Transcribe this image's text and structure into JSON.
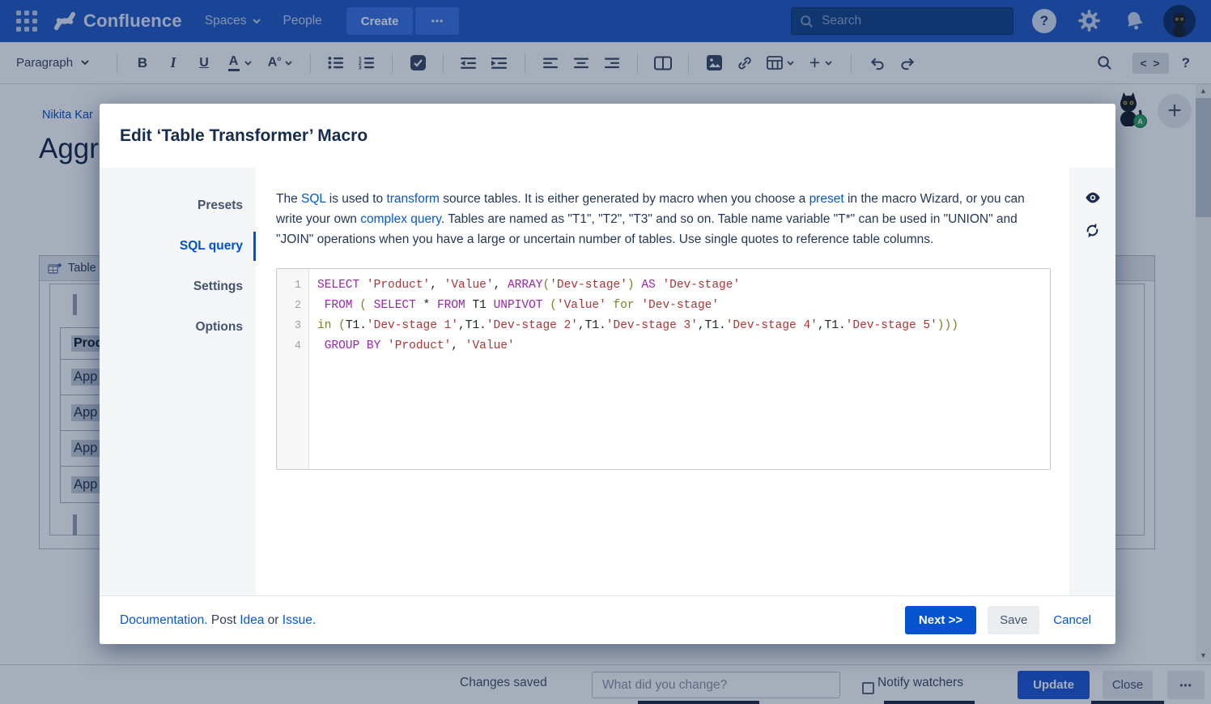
{
  "nav": {
    "brand": "Confluence",
    "spaces_label": "Spaces",
    "people_label": "People",
    "create_label": "Create",
    "more_label": "•••",
    "search_placeholder": "Search",
    "help_label": "?"
  },
  "toolbar": {
    "paragraph_label": "Paragraph",
    "code_view_label": "< >",
    "help_label": "?",
    "plus_label": "+"
  },
  "background": {
    "breadcrumb": "Nikita Kar",
    "page_title": "Aggr",
    "macro_label": "Table",
    "table": {
      "header": "Prod",
      "rows": [
        "App '",
        "App '",
        "App '",
        "App '"
      ]
    },
    "collab_badge": "A",
    "plus_label": "+"
  },
  "dialog": {
    "title": "Edit ‘Table Transformer’ Macro",
    "tabs": [
      {
        "label": "Presets",
        "active": false
      },
      {
        "label": "SQL query",
        "active": true
      },
      {
        "label": "Settings",
        "active": false
      },
      {
        "label": "Options",
        "active": false
      }
    ],
    "description": [
      {
        "t": "The "
      },
      {
        "t": "SQL",
        "link": true
      },
      {
        "t": " is used to "
      },
      {
        "t": "transform",
        "link": true
      },
      {
        "t": " source tables. It is either generated by macro when you choose a "
      },
      {
        "t": "preset",
        "link": true
      },
      {
        "t": " in the macro Wizard, or you can write your own "
      },
      {
        "t": "complex query",
        "link": true
      },
      {
        "t": ". Tables are named as \"T1\", \"T2\", \"T3\" and so on. Table name variable \"T*\" can be used in \"UNION\" and \"JOIN\" operations when you have a large or uncertain number of tables. Use single quotes to reference table columns."
      }
    ],
    "code": {
      "lines": [
        {
          "n": "1",
          "tokens": [
            [
              "k",
              "SELECT"
            ],
            [
              "t",
              " "
            ],
            [
              "s",
              "'Product'"
            ],
            [
              "t",
              ", "
            ],
            [
              "s",
              "'Value'"
            ],
            [
              "t",
              ", "
            ],
            [
              "k",
              "ARRAY"
            ],
            [
              "p",
              "("
            ],
            [
              "s",
              "'Dev-stage'"
            ],
            [
              "p",
              ")"
            ],
            [
              "t",
              " "
            ],
            [
              "k",
              "AS"
            ],
            [
              "t",
              " "
            ],
            [
              "s",
              "'Dev-stage'"
            ]
          ]
        },
        {
          "n": "2",
          "tokens": [
            [
              "t",
              " "
            ],
            [
              "k",
              "FROM"
            ],
            [
              "t",
              " "
            ],
            [
              "p",
              "("
            ],
            [
              "t",
              " "
            ],
            [
              "k",
              "SELECT"
            ],
            [
              "t",
              " * "
            ],
            [
              "k",
              "FROM"
            ],
            [
              "t",
              " T1 "
            ],
            [
              "k",
              "UNPIVOT"
            ],
            [
              "t",
              " "
            ],
            [
              "p",
              "("
            ],
            [
              "s",
              "'Value'"
            ],
            [
              "t",
              " "
            ],
            [
              "p",
              "for"
            ],
            [
              "t",
              " "
            ],
            [
              "s",
              "'Dev-stage'"
            ]
          ]
        },
        {
          "n": "3",
          "tokens": [
            [
              "p",
              "in"
            ],
            [
              "t",
              " "
            ],
            [
              "p",
              "("
            ],
            [
              "t",
              "T1."
            ],
            [
              "s",
              "'Dev-stage 1'"
            ],
            [
              "t",
              ",T1."
            ],
            [
              "s",
              "'Dev-stage 2'"
            ],
            [
              "t",
              ",T1."
            ],
            [
              "s",
              "'Dev-stage 3'"
            ],
            [
              "t",
              ",T1."
            ],
            [
              "s",
              "'Dev-stage 4'"
            ],
            [
              "t",
              ",T1."
            ],
            [
              "s",
              "'Dev-stage 5'"
            ],
            [
              "p",
              ")))"
            ]
          ]
        },
        {
          "n": "4",
          "tokens": [
            [
              "t",
              " "
            ],
            [
              "k",
              "GROUP"
            ],
            [
              "t",
              " "
            ],
            [
              "k",
              "BY"
            ],
            [
              "t",
              " "
            ],
            [
              "s",
              "'Product'"
            ],
            [
              "t",
              ", "
            ],
            [
              "s",
              "'Value'"
            ]
          ]
        }
      ]
    },
    "footer": {
      "links": [
        {
          "t": "Documentation.",
          "link": true
        },
        {
          "t": " Post "
        },
        {
          "t": "Idea",
          "link": true
        },
        {
          "t": " or "
        },
        {
          "t": "Issue.",
          "link": true
        }
      ],
      "next_label": "Next >>",
      "save_label": "Save",
      "cancel_label": "Cancel"
    }
  },
  "bottom_bar": {
    "status": "Changes saved",
    "comment_placeholder": "What did you change?",
    "notify_label": "Notify watchers",
    "update_label": "Update",
    "close_label": "Close",
    "more_label": "•••"
  },
  "colors": {
    "accent_blue": "#0052CC",
    "nav_blue": "#2559C5",
    "badge_green": "#2FA360",
    "code_keyword": "#9E23B0",
    "code_string": "#B03434",
    "code_paren": "#7D7F24"
  }
}
